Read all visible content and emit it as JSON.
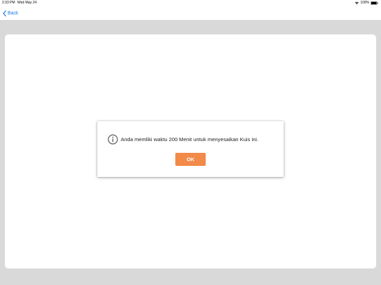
{
  "status_bar": {
    "time": "2:33 PM",
    "date": "Wed May 24",
    "battery": "100%"
  },
  "nav": {
    "back_label": "Back"
  },
  "dialog": {
    "message": "Anda memliki waktu 200 Menit untuk menyesaikan Kuis ini.",
    "ok_label": "OK",
    "icon": "info-icon"
  },
  "colors": {
    "accent": "#f28a4a",
    "link": "#1a7ee6",
    "background": "#d9d9d9"
  }
}
